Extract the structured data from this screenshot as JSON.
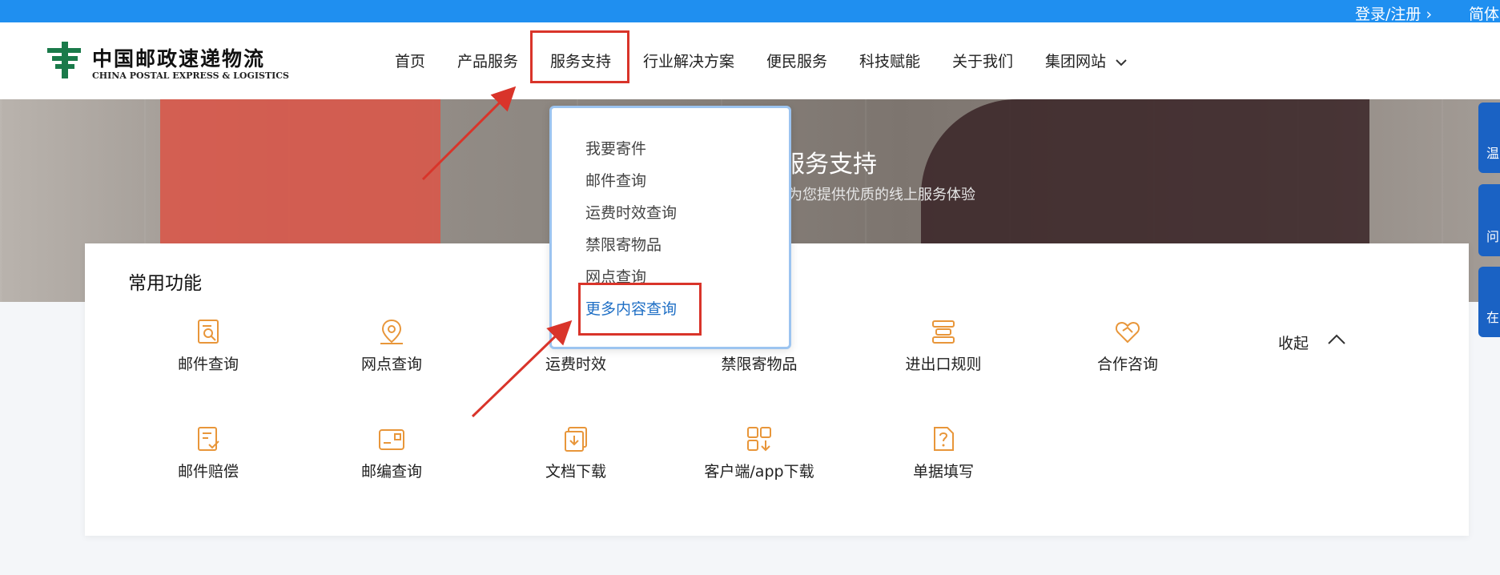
{
  "topbar": {
    "login": "登录/注册 ›",
    "lang": "简体"
  },
  "logo": {
    "cn": "中国邮政速递物流",
    "en": "CHINA POSTAL EXPRESS & LOGISTICS"
  },
  "nav": [
    "首页",
    "产品服务",
    "服务支持",
    "行业解决方案",
    "便民服务",
    "科技赋能",
    "关于我们",
    "集团网站"
  ],
  "banner": {
    "title": "服务支持",
    "subtitle": "为您提供优质的线上服务体验"
  },
  "side_tabs": [
    "温",
    "问",
    "在"
  ],
  "dropdown": [
    "我要寄件",
    "邮件查询",
    "运费时效查询",
    "禁限寄物品",
    "网点查询",
    "更多内容查询"
  ],
  "panel": {
    "title": "常用功能",
    "collapse": "收起",
    "features": [
      {
        "label": "邮件查询",
        "icon": "mail-search-icon"
      },
      {
        "label": "网点查询",
        "icon": "location-pin-icon"
      },
      {
        "label": "运费时效",
        "icon": "freight-time-icon"
      },
      {
        "label": "禁限寄物品",
        "icon": "prohibited-items-icon"
      },
      {
        "label": "进出口规则",
        "icon": "import-export-rules-icon"
      },
      {
        "label": "合作咨询",
        "icon": "handshake-heart-icon"
      },
      {
        "label": "邮件赔偿",
        "icon": "compensation-icon"
      },
      {
        "label": "邮编查询",
        "icon": "postcode-card-icon"
      },
      {
        "label": "文档下载",
        "icon": "document-download-icon"
      },
      {
        "label": "客户端/app下载",
        "icon": "app-download-icon"
      },
      {
        "label": "单据填写",
        "icon": "form-question-icon"
      }
    ]
  },
  "colors": {
    "accent": "#1f8ff0",
    "icon": "#e8963a",
    "highlight": "#d9342a",
    "link_active": "#1f6fc5"
  }
}
